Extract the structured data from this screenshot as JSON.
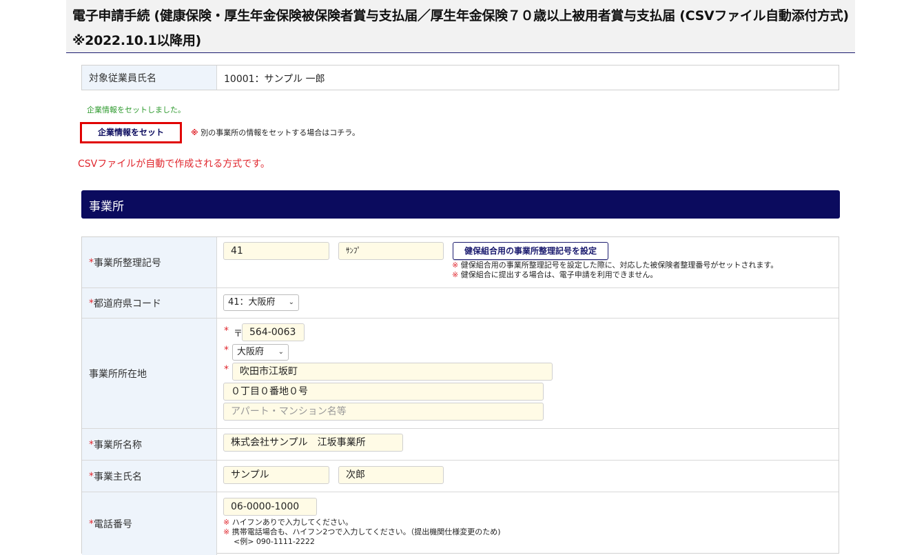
{
  "page": {
    "title": "電子申請手続 (健康保険・厚生年金保険被保険者賞与支払届／厚生年金保険７０歳以上被用者賞与支払届 (CSVファイル自動添付方式)　※2022.10.1以降用)"
  },
  "employee": {
    "label": "対象従業員氏名",
    "value": "10001：サンプル 一郎"
  },
  "company": {
    "status_message": "企業情報をセットしました。",
    "set_button": "企業情報をセット",
    "note_mark": "※",
    "note": "別の事業所の情報をセットする場合はコチラ。"
  },
  "csv_notice": "CSVファイルが自動で作成される方式です。",
  "section": {
    "title": "事業所"
  },
  "form": {
    "required_mark": "*",
    "office_code": {
      "label": "事業所整理記号",
      "value1": "41",
      "value2": "ｻﾝﾌﾟ",
      "button": "健保組合用の事業所整理記号を設定",
      "notes": [
        "健保組合用の事業所整理記号を設定した際に、対応した被保険者整理番号がセットされます。",
        "健保組合に提出する場合は、電子申請を利用できません。"
      ]
    },
    "prefecture_code": {
      "label": "都道府県コード",
      "selected": "41：大阪府"
    },
    "address": {
      "label": "事業所所在地",
      "postal_mark": "〒",
      "postal": "564-0063",
      "prefecture": "大阪府",
      "city": "吹田市江坂町",
      "street": "０丁目０番地０号",
      "building_placeholder": "アパート・マンション名等"
    },
    "office_name": {
      "label": "事業所名称",
      "value": "株式会社サンプル　江坂事業所"
    },
    "owner_name": {
      "label": "事業主氏名",
      "last": "サンプル",
      "first": "次郎"
    },
    "phone": {
      "label": "電話番号",
      "value": "06-0000-1000",
      "notes": [
        "ハイフンありで入力してください。",
        "携帯電話場合も、ハイフン2つで入力してください。（提出機関仕様変更のため)"
      ],
      "example": "<例> 090-1111-2222"
    }
  },
  "colors": {
    "navy": "#0b0b5e",
    "required_red": "#e0262d",
    "input_bg": "#fffbe6",
    "label_bg": "#eef4fb",
    "success_green": "#2e9a2e"
  }
}
